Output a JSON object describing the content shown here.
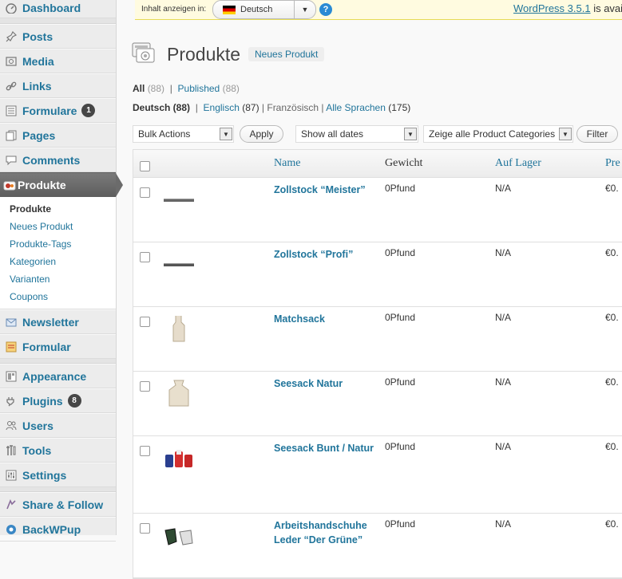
{
  "sidebar": {
    "items": [
      {
        "label": "Dashboard",
        "icon": "dashboard-icon"
      },
      {
        "label": "Posts",
        "icon": "pin-icon"
      },
      {
        "label": "Media",
        "icon": "media-icon"
      },
      {
        "label": "Links",
        "icon": "link-icon"
      },
      {
        "label": "Formulare",
        "icon": "form-icon",
        "badge": "1"
      },
      {
        "label": "Pages",
        "icon": "pages-icon"
      },
      {
        "label": "Comments",
        "icon": "comment-icon"
      },
      {
        "label": "Produkte",
        "icon": "products-icon"
      },
      {
        "label": "Newsletter",
        "icon": "mail-icon"
      },
      {
        "label": "Formular",
        "icon": "form-icon"
      },
      {
        "label": "Appearance",
        "icon": "appearance-icon"
      },
      {
        "label": "Plugins",
        "icon": "plugin-icon",
        "badge": "8"
      },
      {
        "label": "Users",
        "icon": "users-icon"
      },
      {
        "label": "Tools",
        "icon": "tools-icon"
      },
      {
        "label": "Settings",
        "icon": "settings-icon"
      },
      {
        "label": "Share & Follow",
        "icon": "share-icon"
      },
      {
        "label": "BackWPup",
        "icon": "backup-icon"
      }
    ],
    "submenu": [
      "Produkte",
      "Neues Produkt",
      "Produkte-Tags",
      "Kategorien",
      "Varianten",
      "Coupons"
    ]
  },
  "topbar": {
    "label": "Inhalt anzeigen in:",
    "language": "Deutsch",
    "update_link": "WordPress 3.5.1",
    "update_text": " is available"
  },
  "header": {
    "title": "Produkte",
    "add_new": "Neues Produkt"
  },
  "status_links": {
    "all": "All",
    "all_count": "(88)",
    "published": "Published",
    "published_count": "(88)"
  },
  "lang_links": {
    "deutsch": "Deutsch (88)",
    "englisch": "Englisch",
    "englisch_count": "(87)",
    "franz": "Französisch",
    "alle": "Alle Sprachen",
    "alle_count": "(175)"
  },
  "filters": {
    "bulk": "Bulk Actions",
    "apply": "Apply",
    "dates": "Show all dates",
    "categories": "Zeige alle Product Categories",
    "filter": "Filter"
  },
  "table": {
    "columns": {
      "name": "Name",
      "weight": "Gewicht",
      "stock": "Auf Lager",
      "price": "Pre"
    },
    "rows": [
      {
        "name": "Zollstock “Meister”",
        "weight": "0Pfund",
        "stock": "N/A",
        "price": "€0.",
        "thumb": "ruler"
      },
      {
        "name": "Zollstock “Profi”",
        "weight": "0Pfund",
        "stock": "N/A",
        "price": "€0.",
        "thumb": "ruler"
      },
      {
        "name": "Matchsack",
        "weight": "0Pfund",
        "stock": "N/A",
        "price": "€0.",
        "thumb": "sack-tall"
      },
      {
        "name": "Seesack Natur",
        "weight": "0Pfund",
        "stock": "N/A",
        "price": "€0.",
        "thumb": "sack"
      },
      {
        "name": "Seesack Bunt / Natur",
        "weight": "0Pfund",
        "stock": "N/A",
        "price": "€0.",
        "thumb": "sacks-colored"
      },
      {
        "name": "Arbeitshandschuhe Leder “Der Grüne”",
        "weight": "0Pfund",
        "stock": "N/A",
        "price": "€0.",
        "thumb": "gloves"
      }
    ]
  }
}
